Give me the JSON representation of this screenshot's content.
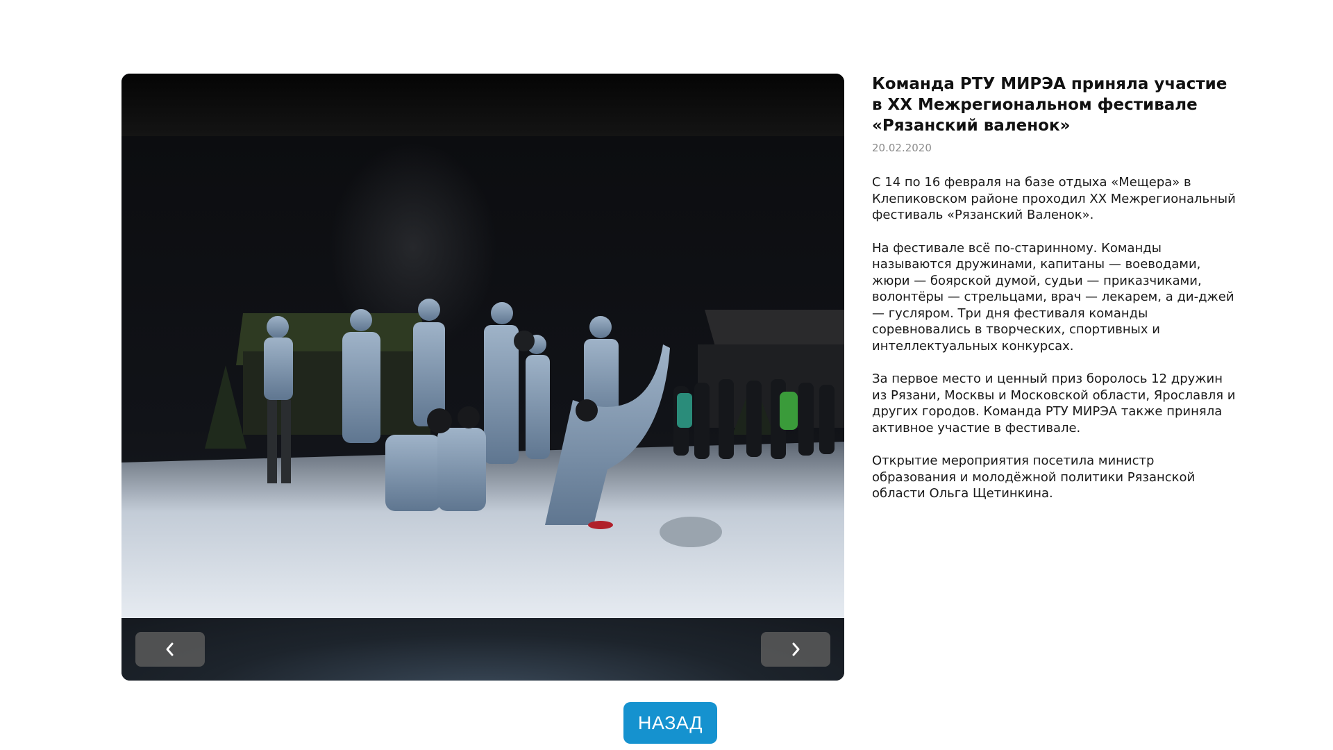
{
  "gallery": {
    "image_alt": "Команда РТУ МИРЭА на фестивале «Рязанский валенок»",
    "prev_icon": "chevron-left-icon",
    "next_icon": "chevron-right-icon"
  },
  "article": {
    "title": "Команда РТУ МИРЭА приняла участие в XX Межрегиональном фестивале «Рязанский валенок»",
    "date": "20.02.2020",
    "paragraphs": [
      "С 14 по 16 февраля на базе отдыха «Мещера» в Клепиковском районе проходил XX Межрегиональный фестиваль «Рязанский Валенок».",
      "На фестивале всё по-старинному. Команды называются дружинами, капитаны — воеводами, жюри — боярской думой, судьи — приказчиками, волонтёры — стрельцами, врач — лекарем, а ди-джей — гусляром. Три дня фестиваля команды соревновались в творческих, спортивных и интеллектуальных конкурсах.",
      "За первое место и ценный приз боролось 12 дружин из Рязани, Москвы и Московской области, Ярославля и других городов. Команда РТУ МИРЭА также приняла активное участие в фестивале.",
      "Открытие мероприятия посетила министр образования и молодёжной политики Рязанской области Ольга Щетинкина."
    ]
  },
  "back_button": {
    "label": "НАЗАД"
  },
  "colors": {
    "accent": "#1592cf",
    "date": "#8c8c8c",
    "nav_button": "#5a5a5a"
  }
}
